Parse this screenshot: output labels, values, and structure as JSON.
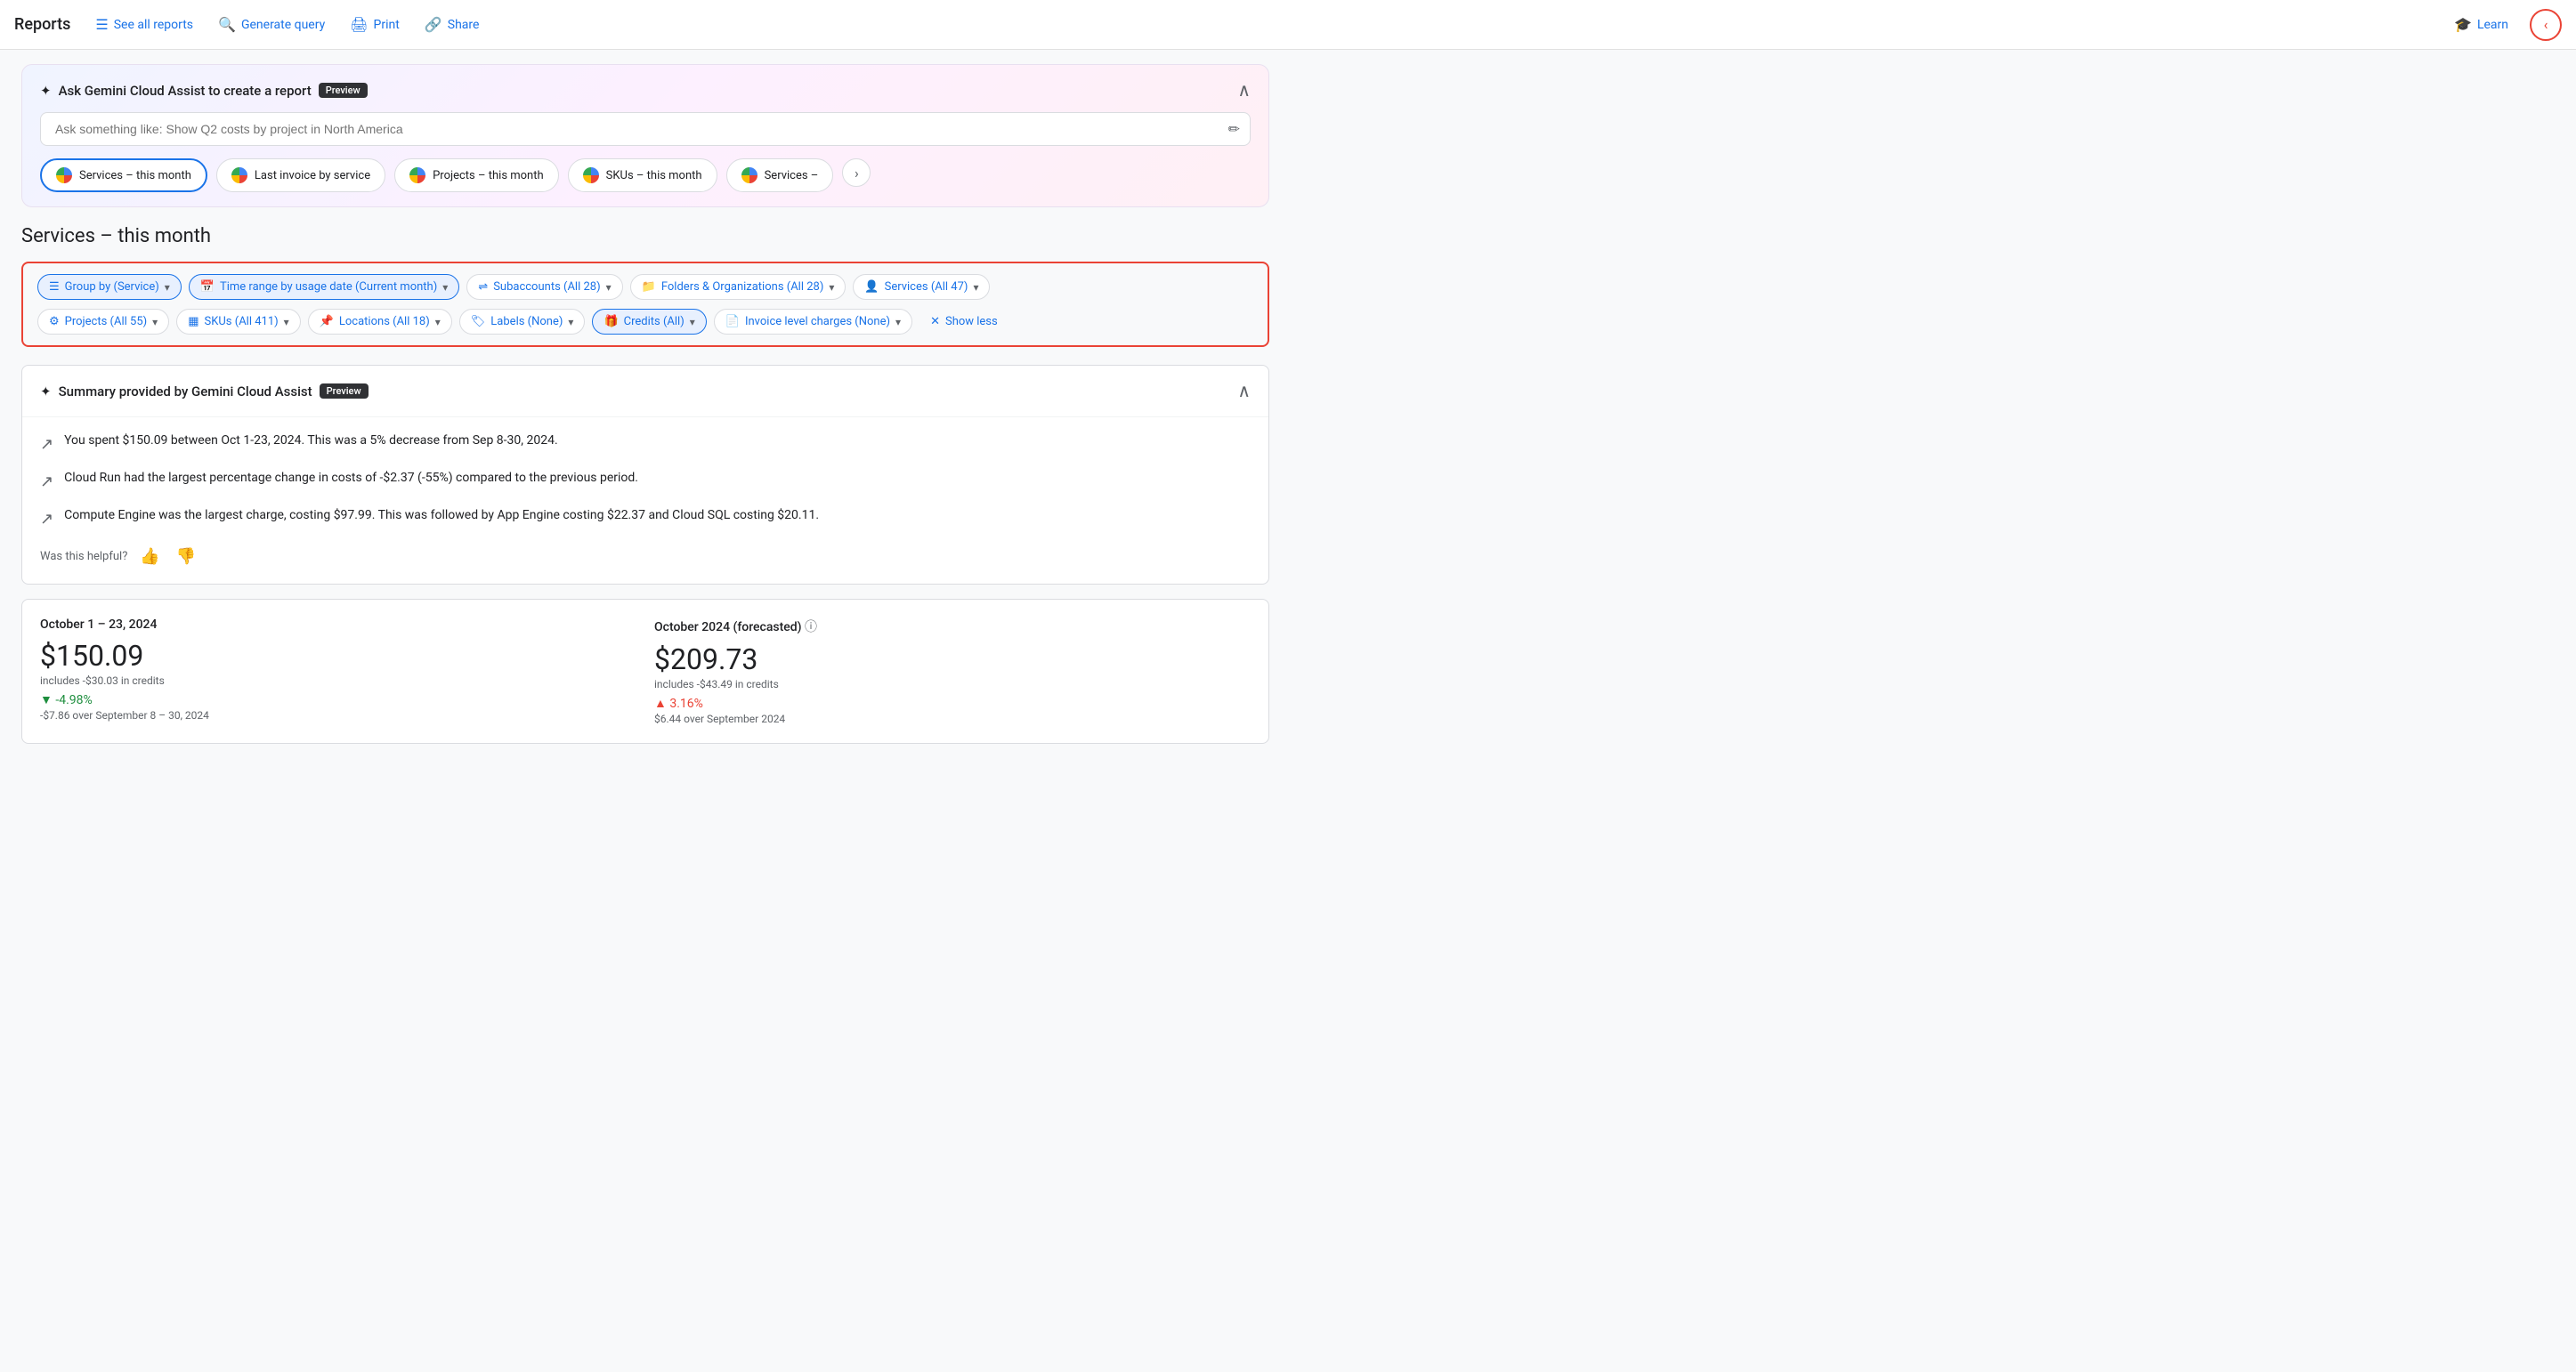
{
  "app": {
    "title": "Reports"
  },
  "nav": {
    "see_all_reports": "See all reports",
    "generate_query": "Generate query",
    "print": "Print",
    "share": "Share",
    "learn": "Learn"
  },
  "gemini": {
    "title": "Ask Gemini Cloud Assist to create a report",
    "preview_badge": "Preview",
    "input_placeholder": "Ask something like: Show Q2 costs by project in North America",
    "collapse_icon": "expand_less"
  },
  "suggestions": [
    {
      "label": "Services – this month",
      "active": true
    },
    {
      "label": "Last invoice by service",
      "active": false
    },
    {
      "label": "Projects – this month",
      "active": false
    },
    {
      "label": "SKUs – this month",
      "active": false
    },
    {
      "label": "Services –",
      "active": false
    }
  ],
  "page_title": "Services – this month",
  "filters": {
    "row1": [
      {
        "label": "Group by (Service)",
        "icon": "☰",
        "active": true
      },
      {
        "label": "Time range by usage date (Current month)",
        "icon": "📅",
        "active": true
      },
      {
        "label": "Subaccounts (All 28)",
        "icon": "⇌",
        "active": false
      },
      {
        "label": "Folders & Organizations (All 28)",
        "icon": "📁",
        "active": false
      },
      {
        "label": "Services (All 47)",
        "icon": "👤",
        "active": false
      }
    ],
    "row2": [
      {
        "label": "Projects (All 55)",
        "icon": "⚙",
        "active": false
      },
      {
        "label": "SKUs (All 411)",
        "icon": "▦",
        "active": false
      },
      {
        "label": "Locations (All 18)",
        "icon": "📌",
        "active": false
      },
      {
        "label": "Labels (None)",
        "icon": "🏷",
        "active": false
      },
      {
        "label": "Credits (All)",
        "icon": "🎁",
        "active": true
      },
      {
        "label": "Invoice level charges (None)",
        "icon": "📄",
        "active": false
      }
    ],
    "show_less": "Show less"
  },
  "summary": {
    "title": "Summary provided by Gemini Cloud Assist",
    "preview_badge": "Preview",
    "items": [
      "You spent $150.09 between Oct 1-23, 2024. This was a 5% decrease from Sep 8-30, 2024.",
      "Cloud Run had the largest percentage change in costs of -$2.37 (-55%) compared to the previous period.",
      "Compute Engine was the largest charge, costing $97.99. This was followed by App Engine costing $22.37 and Cloud SQL costing $20.11."
    ],
    "helpful_label": "Was this helpful?"
  },
  "cost": {
    "period1": {
      "label": "October 1 – 23, 2024",
      "amount": "$150.09",
      "credits": "includes -$30.03 in credits",
      "change": "▼ -4.98%",
      "change_type": "down",
      "change_detail": "-$7.86 over September 8 – 30, 2024"
    },
    "period2": {
      "label": "October 2024 (forecasted)",
      "amount": "$209.73",
      "credits": "includes -$43.49 in credits",
      "change": "▲ 3.16%",
      "change_type": "up",
      "change_detail": "$6.44 over September 2024"
    }
  }
}
